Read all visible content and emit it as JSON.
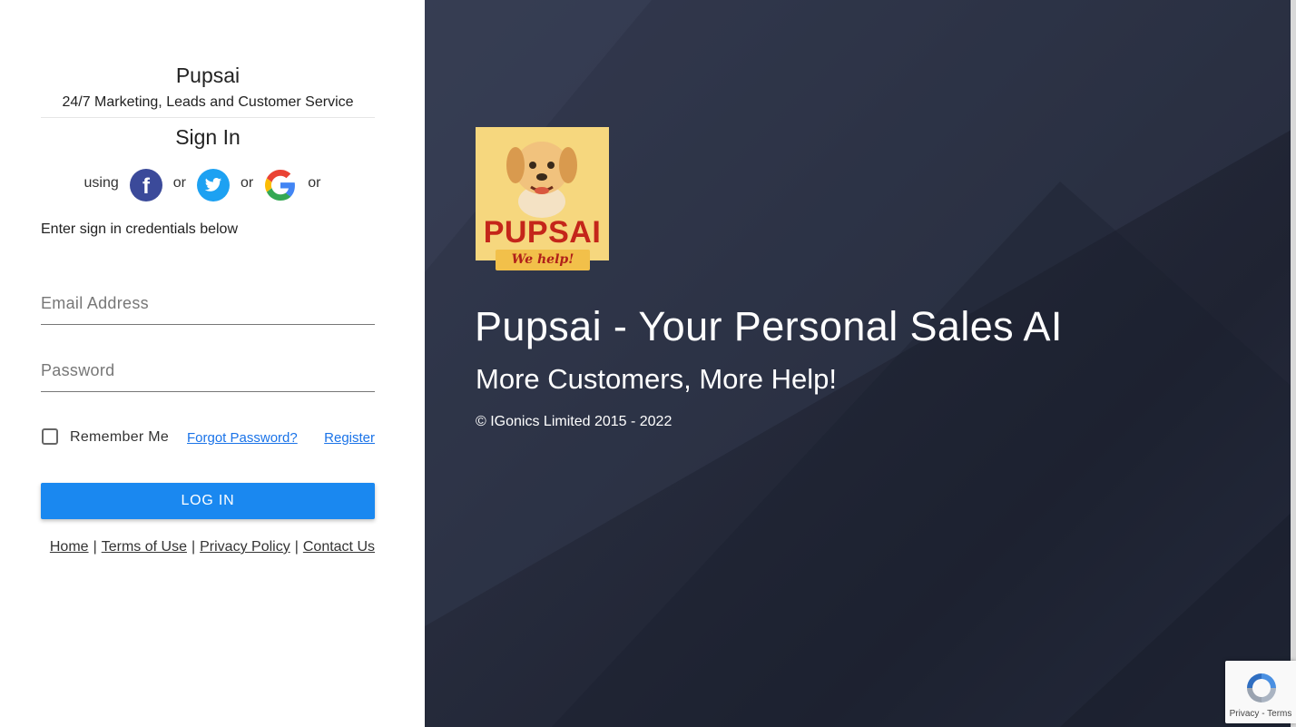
{
  "app": {
    "name": "Pupsai",
    "tagline": "24/7 Marketing, Leads and Customer Service"
  },
  "signin": {
    "title": "Sign In",
    "using": "using",
    "or": "or",
    "providers": [
      "facebook",
      "twitter",
      "google"
    ],
    "instructions": "Enter sign in credentials below",
    "email_placeholder": "Email Address",
    "email_value": "",
    "password_placeholder": "Password",
    "password_value": "",
    "remember_label": "Remember Me",
    "remember_checked": false,
    "forgot_label": "Forgot Password?",
    "register_label": "Register",
    "login_label": "LOG IN"
  },
  "footer": {
    "links": [
      "Home",
      "Terms of Use",
      "Privacy Policy",
      "Contact Us"
    ],
    "separator": "|"
  },
  "hero": {
    "logo_text": "PUPSAI",
    "logo_ribbon": "We help!",
    "title": "Pupsai - Your Personal Sales AI",
    "subtitle": "More Customers, More Help!",
    "copyright": "© IGonics Limited 2015 - 2022"
  },
  "recaptcha": {
    "privacy": "Privacy",
    "dash": "-",
    "terms": "Terms"
  },
  "colors": {
    "primary_button": "#1a88f0",
    "link": "#1a73e8",
    "facebook": "#3b4a9a",
    "twitter": "#1da1f2",
    "hero_bg": "#262b3c",
    "logo_bg": "#f6d77e",
    "logo_text": "#c4261a"
  },
  "icons": {
    "facebook": "facebook-icon",
    "twitter": "twitter-icon",
    "google": "google-icon",
    "checkbox": "checkbox-icon",
    "recaptcha": "recaptcha-icon"
  }
}
